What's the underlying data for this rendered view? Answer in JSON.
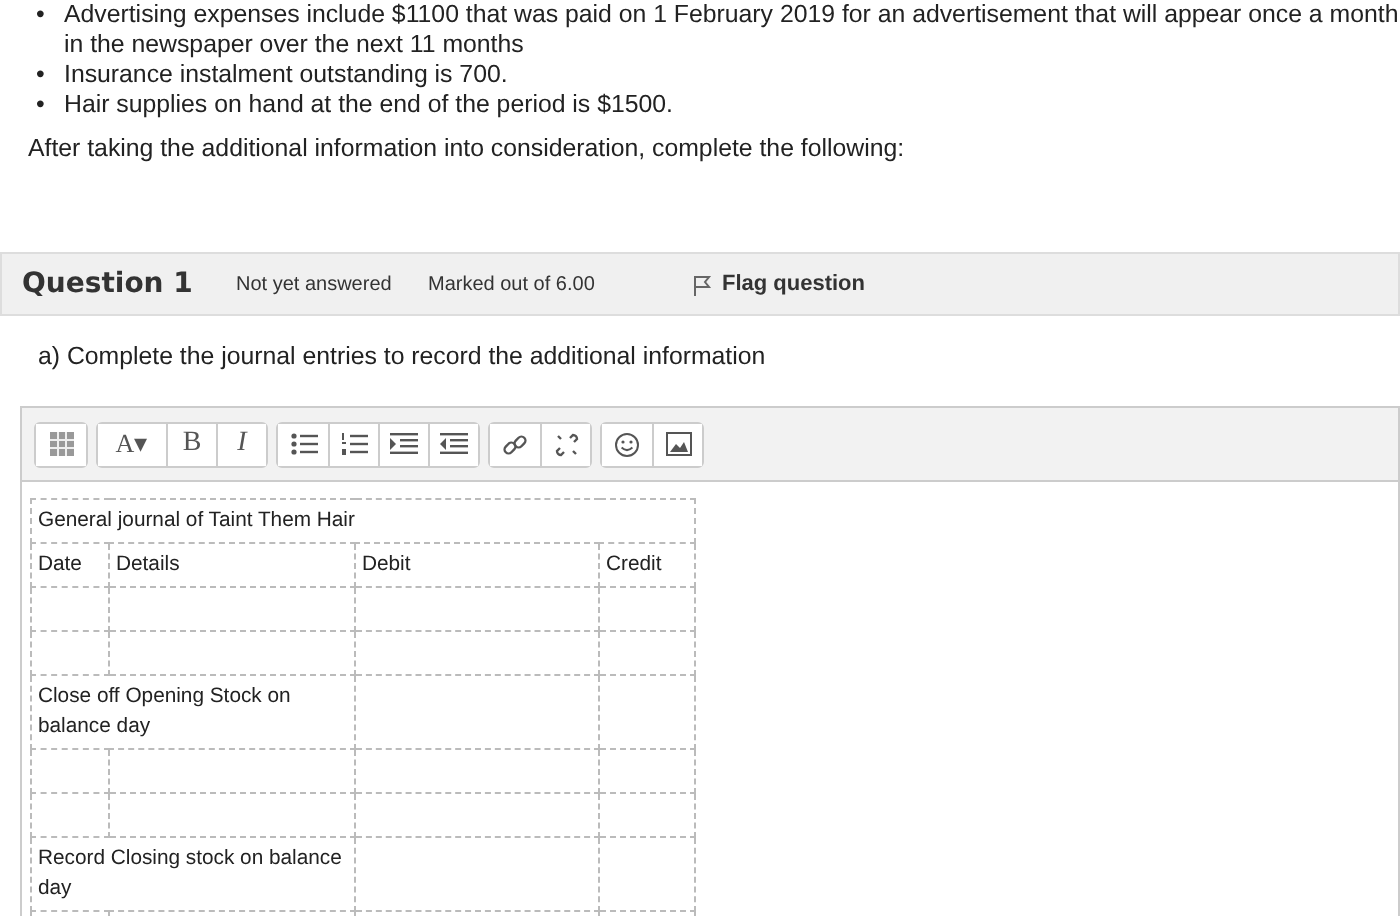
{
  "bullets": [
    {
      "marker": "•",
      "text": "Advertising expenses include $1100 that was paid on 1 February 2019 for an advertisement that will appear once a month in the newspaper over the next 11 months"
    },
    {
      "marker": "•",
      "text": "Insurance instalment outstanding is 700."
    },
    {
      "marker": "•",
      "text": "Hair supplies on hand at the end of the period is $1500."
    }
  ],
  "instruction": "After taking the additional information into consideration, complete the following:",
  "question": {
    "title": "Question 1",
    "status": "Not yet answered",
    "marks": "Marked out of 6.00",
    "flag": "Flag question"
  },
  "prompt": "a) Complete the journal entries to record the additional information",
  "toolbar": [
    [
      {
        "kind": "table"
      }
    ],
    [
      {
        "kind": "font",
        "text": "A▾"
      },
      {
        "kind": "bold",
        "text": "B"
      },
      {
        "kind": "italic",
        "text": "I"
      }
    ],
    [
      {
        "kind": "bullets"
      },
      {
        "kind": "numbers"
      },
      {
        "kind": "indent"
      },
      {
        "kind": "outdent"
      }
    ],
    [
      {
        "kind": "link"
      },
      {
        "kind": "unlink"
      }
    ],
    [
      {
        "kind": "emoji"
      },
      {
        "kind": "image"
      }
    ]
  ],
  "journal": {
    "title": "General journal of Taint Them Hair",
    "columns": [
      "Date",
      "Details",
      "Debit",
      "Credit"
    ],
    "rows": [
      {
        "kind": "blank"
      },
      {
        "kind": "blank"
      },
      {
        "kind": "entry",
        "text": "Close off Opening Stock on balance day"
      },
      {
        "kind": "blank"
      },
      {
        "kind": "blank"
      },
      {
        "kind": "entry",
        "text": "Record Closing stock on balance day"
      },
      {
        "kind": "blank"
      }
    ]
  }
}
